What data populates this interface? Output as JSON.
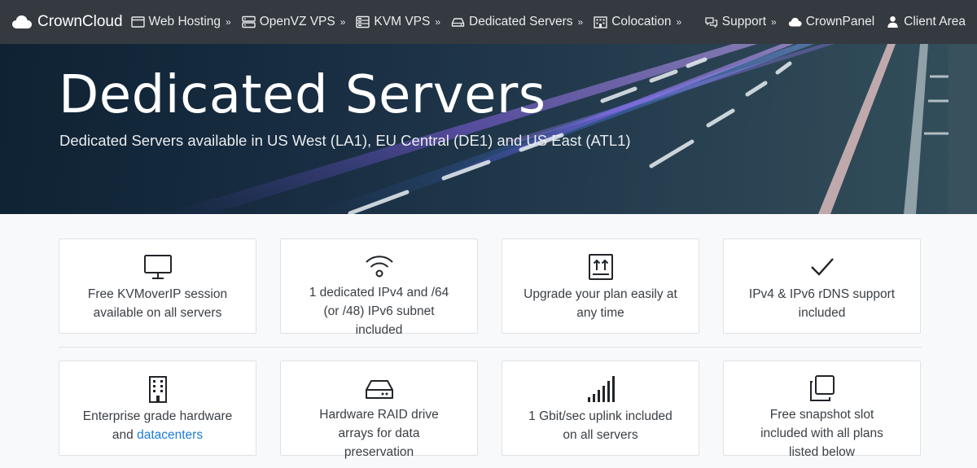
{
  "nav": {
    "brand": "CrownCloud",
    "items": [
      {
        "label": "Web Hosting",
        "icon": "browser-window-icon"
      },
      {
        "label": "OpenVZ VPS",
        "icon": "server-icon"
      },
      {
        "label": "KVM VPS",
        "icon": "server-rack-icon"
      },
      {
        "label": "Dedicated Servers",
        "icon": "hard-drive-icon"
      },
      {
        "label": "Colocation",
        "icon": "building-icon"
      }
    ],
    "right": [
      {
        "label": "Support",
        "icon": "chat-icon"
      },
      {
        "label": "CrownPanel",
        "icon": "cloud-icon"
      },
      {
        "label": "Client Area",
        "icon": "user-icon"
      }
    ]
  },
  "hero": {
    "title": "Dedicated Servers",
    "subtitle": "Dedicated Servers available in US West (LA1), EU Central (DE1) and US East (ATL1)"
  },
  "features": {
    "row1": [
      {
        "icon": "monitor-icon",
        "text": "Free KVMoverIP session available on all servers"
      },
      {
        "icon": "wifi-icon",
        "text": "1 dedicated IPv4 and /64 (or /48) IPv6 subnet included"
      },
      {
        "icon": "upgrade-box-icon",
        "text": "Upgrade your plan easily at any time"
      },
      {
        "icon": "checkmark-icon",
        "text": "IPv4 & IPv6 rDNS support included"
      }
    ],
    "row2": [
      {
        "icon": "building-icon",
        "text_before": "Enterprise grade hardware and ",
        "link": "datacenters"
      },
      {
        "icon": "hard-drive-icon",
        "text": "Hardware RAID drive arrays for data preservation"
      },
      {
        "icon": "signal-bars-icon",
        "text": "1 Gbit/sec uplink included on all servers"
      },
      {
        "icon": "snapshot-copy-icon",
        "text": "Free snapshot slot included with all plans listed below"
      }
    ]
  },
  "colors": {
    "navbar": "#343a40",
    "link": "#1e7bd6",
    "page_bg": "#f8f9fa"
  }
}
